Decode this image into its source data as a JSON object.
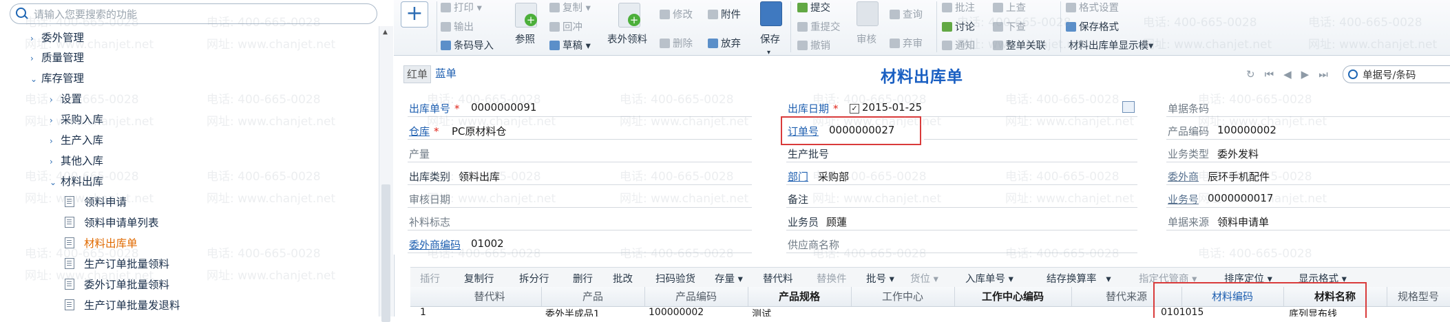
{
  "sidebar": {
    "search_placeholder": "请输入您要搜索的功能",
    "items": [
      {
        "label": "委外管理",
        "arrow": "›"
      },
      {
        "label": "质量管理",
        "arrow": "›"
      },
      {
        "label": "库存管理",
        "arrow": "⌄"
      },
      {
        "label": "设置",
        "arrow": "›"
      },
      {
        "label": "采购入库",
        "arrow": "›"
      },
      {
        "label": "生产入库",
        "arrow": "›"
      },
      {
        "label": "其他入库",
        "arrow": "›"
      },
      {
        "label": "材料出库",
        "arrow": "⌄"
      },
      {
        "label": "领料申请"
      },
      {
        "label": "领料申请单列表"
      },
      {
        "label": "材料出库单"
      },
      {
        "label": "生产订单批量领料"
      },
      {
        "label": "委外订单批量领料"
      },
      {
        "label": "生产订单批量发退料"
      }
    ]
  },
  "toolbar": {
    "print": "打印",
    "export": "输出",
    "barcode_import": "条码导入",
    "reference": "参照",
    "copy": "复制",
    "write_back": "回冲",
    "draft": "草稿",
    "outside_pick": "表外领料",
    "modify": "修改",
    "attachment": "附件",
    "delete": "删除",
    "discard": "放弃",
    "save": "保存",
    "submit": "提交",
    "resubmit": "重提交",
    "withdraw": "撤销",
    "audit": "审核",
    "query": "查询",
    "abandon": "弃审",
    "approve_note": "批注",
    "discuss": "讨论",
    "notify": "通知",
    "prev": "上查",
    "next": "下查",
    "link_all": "整单关联",
    "format_setting": "格式设置",
    "save_format": "保存格式",
    "display_template": "材料出库单显示模▾"
  },
  "titlebar": {
    "red": "红单",
    "blue": "蓝单",
    "title": "材料出库单",
    "search_placeholder": "单据号/条码"
  },
  "form": {
    "out_no_label": "出库单号",
    "out_no": "0000000091",
    "warehouse_label": "仓库",
    "warehouse": "PC原材料仓",
    "output_label": "产量",
    "out_type_label": "出库类别",
    "out_type": "领料出库",
    "audit_date_label": "审核日期",
    "supplement_label": "补料标志",
    "vendor_code_label": "委外商编码",
    "vendor_code": "01002",
    "out_date_label": "出库日期",
    "out_date": "2015-01-25",
    "order_no_label": "订单号",
    "order_no": "0000000027",
    "batch_label": "生产批号",
    "dept_label": "部门",
    "dept": "采购部",
    "remark_label": "备注",
    "salesman_label": "业务员",
    "salesman": "顾蓮",
    "supplier_label": "供应商名称",
    "barcode_label": "单据条码",
    "product_code_label": "产品编码",
    "product_code": "100000002",
    "biz_type_label": "业务类型",
    "biz_type": "委外发料",
    "vendor_label": "委外商",
    "vendor": "辰环手机配件",
    "biz_no_label": "业务号",
    "biz_no": "0000000017",
    "source_label": "单据来源",
    "source": "领料申请单"
  },
  "gridbar": [
    "插行",
    "复制行",
    "拆分行",
    "删行",
    "批改",
    "扫码验货",
    "存量",
    "替代料",
    "替换件",
    "批号",
    "货位",
    "入库单号",
    "结存换算率",
    "指定代管商",
    "排序定位",
    "显示格式"
  ],
  "grid": {
    "headers": [
      "替代料",
      "产品",
      "产品编码",
      "产品规格",
      "工作中心",
      "工作中心编码",
      "替代来源",
      "材料编码",
      "材料名称",
      "规格型号"
    ],
    "row": [
      "1",
      "委外半成品1",
      "100000002",
      "测试",
      "0101015",
      "底列显布线"
    ]
  },
  "watermark": {
    "phone": "电话: 400-665-0028",
    "site": "网址: www.chanjet.net"
  }
}
